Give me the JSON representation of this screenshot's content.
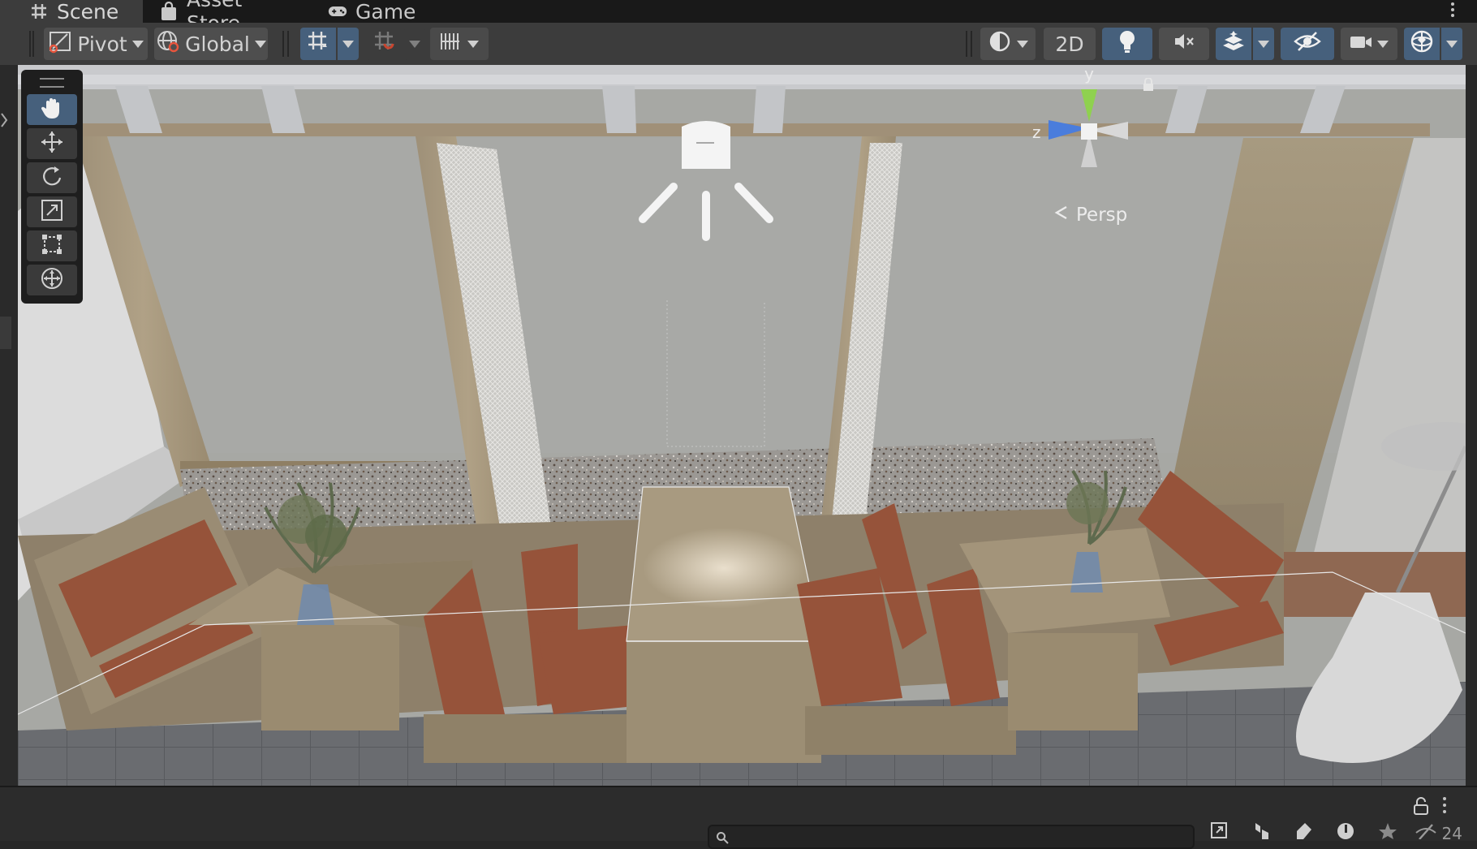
{
  "tabs": [
    {
      "label": "Scene",
      "icon": "grid-hash-icon",
      "active": true
    },
    {
      "label": "Asset Store",
      "icon": "shopping-bag-icon",
      "active": false
    },
    {
      "label": "Game",
      "icon": "gamepad-icon",
      "active": false
    }
  ],
  "toolbar": {
    "pivot_label": "Pivot",
    "global_label": "Global",
    "two_d_label": "2D",
    "grid_snapping_icon": "grid-snapping-icon",
    "increment_snap_icon": "increment-snap-icon",
    "ruler_icon": "ruler-icon",
    "draw_mode_icon": "shaded-sphere-icon",
    "lighting_icon": "lightbulb-icon",
    "audio_icon": "audio-mute-icon",
    "effects_icon": "effects-layers-icon",
    "visibility_icon": "scene-visibility-icon",
    "camera_icon": "camera-icon",
    "gizmos_icon": "gizmos-sphere-icon"
  },
  "tools": [
    {
      "name": "hand-tool",
      "icon": "hand-icon",
      "active": true
    },
    {
      "name": "move-tool",
      "icon": "move-arrows-icon",
      "active": false
    },
    {
      "name": "rotate-tool",
      "icon": "rotate-icon",
      "active": false
    },
    {
      "name": "scale-tool",
      "icon": "scale-icon",
      "active": false
    },
    {
      "name": "rect-tool",
      "icon": "rect-icon",
      "active": false
    },
    {
      "name": "transform-tool",
      "icon": "transform-icon",
      "active": false
    }
  ],
  "gizmo": {
    "y_label": "y",
    "z_label": "z",
    "persp_label": "Persp"
  },
  "bottom": {
    "search_placeholder": "",
    "hidden_count": "24"
  },
  "colors": {
    "toolbar_bg": "#3c3c3c",
    "active_blue": "#46607c",
    "tab_bar_bg": "#191919",
    "gizmo_y": "#8fd14f",
    "gizmo_z": "#4a7ddc"
  }
}
